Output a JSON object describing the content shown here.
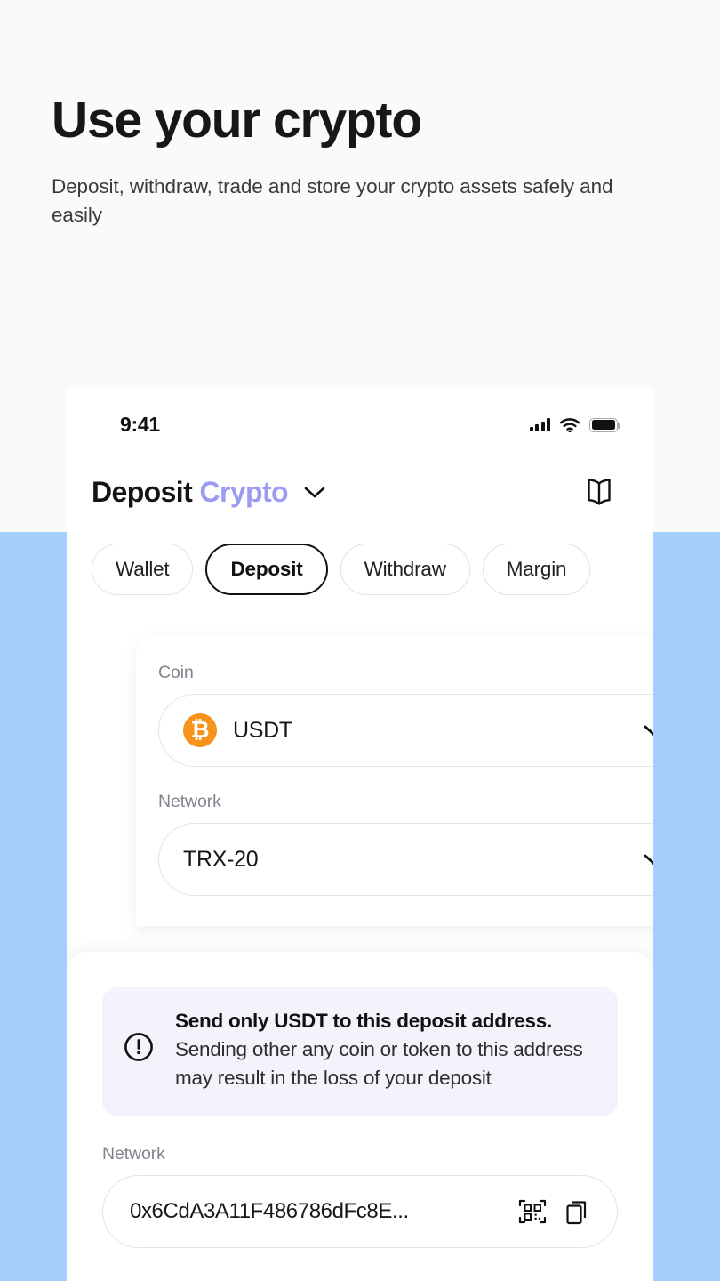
{
  "hero": {
    "title": "Use your crypto",
    "subtitle": "Deposit, withdraw, trade and store  your crypto assets safely and easily"
  },
  "colors": {
    "page_background": "#fafaf9",
    "band_blue": "#a5cffa",
    "accent_purple": "#9b9bf2",
    "coin_orange": "#f7931a",
    "notice_background": "#f3f3fb",
    "text_primary": "#17171a",
    "text_muted": "#83838d"
  },
  "phone": {
    "status_bar": {
      "time": "9:41",
      "icons": [
        "signal-bars-icon",
        "wifi-icon",
        "battery-icon"
      ]
    },
    "header": {
      "title": "Deposit",
      "title_accent": "Crypto",
      "dropdown_icon": "chevron-down-icon",
      "action_icon": "address-book-icon"
    },
    "tabs": [
      {
        "label": "Wallet",
        "active": false
      },
      {
        "label": "Deposit",
        "active": true
      },
      {
        "label": "Withdraw",
        "active": false
      },
      {
        "label": "Margin",
        "active": false
      }
    ],
    "form": {
      "coin": {
        "label": "Coin",
        "value": "USDT",
        "icon": "bitcoin-icon",
        "icon_glyph": "₿",
        "chevron": "chevron-down-icon"
      },
      "network": {
        "label": "Network",
        "value": "TRX-20",
        "chevron": "chevron-down-icon"
      }
    },
    "notice": {
      "icon": "exclamation-circle-icon",
      "heading": "Send only USDT to this deposit address.",
      "body": "Sending other any coin or token to this address may result in the loss of your deposit"
    },
    "address": {
      "label": "Network",
      "value": "0x6CdA3A11F486786dFc8E...",
      "qr_icon": "qr-scan-icon",
      "copy_icon": "copy-icon"
    }
  }
}
